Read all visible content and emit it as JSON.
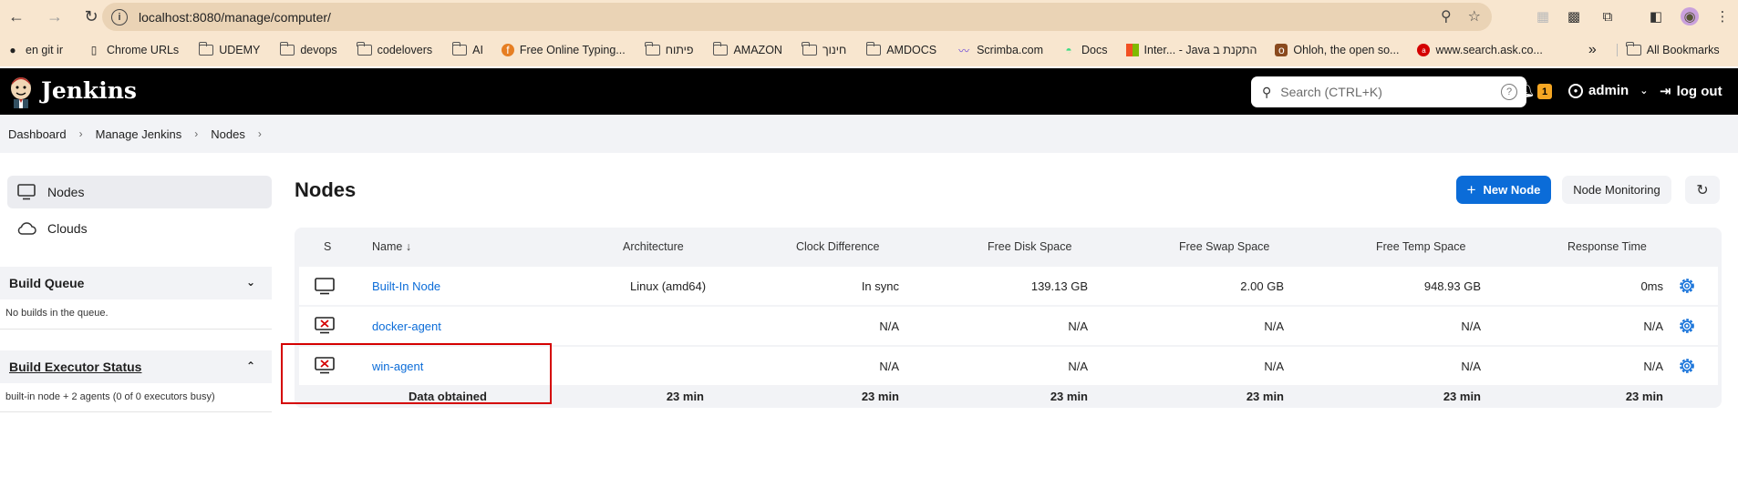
{
  "browser": {
    "url": "localhost:8080/manage/computer/",
    "bookmarks": [
      "en git ir",
      "Chrome URLs",
      "UDEMY",
      "devops",
      "codelovers",
      "AI",
      "Free Online Typing...",
      "פיתוח",
      "AMAZON",
      "חינוך",
      "AMDOCS",
      "Scrimba.com",
      "Docs",
      "Inter... - Java התקנת ב",
      "Ohloh, the open so...",
      "www.search.ask.co..."
    ],
    "all_bookmarks": "All Bookmarks"
  },
  "header": {
    "brand": "Jenkins",
    "search_placeholder": "Search (CTRL+K)",
    "notification_count": "1",
    "user": "admin",
    "logout": "log out"
  },
  "breadcrumb": [
    "Dashboard",
    "Manage Jenkins",
    "Nodes"
  ],
  "sidebar": {
    "items": [
      {
        "label": "Nodes",
        "icon": "computer-icon"
      },
      {
        "label": "Clouds",
        "icon": "cloud-icon"
      }
    ],
    "build_queue": {
      "title": "Build Queue",
      "body": "No builds in the queue."
    },
    "executor_status": {
      "title": "Build Executor Status",
      "body": "built-in node + 2 agents (0 of 0 executors busy)"
    }
  },
  "main": {
    "title": "Nodes",
    "new_node": "New Node",
    "node_monitoring": "Node Monitoring",
    "columns": [
      "S",
      "Name ↓",
      "Architecture",
      "Clock Difference",
      "Free Disk Space",
      "Free Swap Space",
      "Free Temp Space",
      "Response Time"
    ],
    "rows": [
      {
        "status": "online",
        "name": "Built-In Node",
        "arch": "Linux (amd64)",
        "clock": "In sync",
        "disk": "139.13 GB",
        "swap": "2.00 GB",
        "temp": "948.93 GB",
        "response": "0ms"
      },
      {
        "status": "offline",
        "name": "docker-agent",
        "arch": "",
        "clock": "N/A",
        "disk": "N/A",
        "swap": "N/A",
        "temp": "N/A",
        "response": "N/A"
      },
      {
        "status": "offline",
        "name": "win-agent",
        "arch": "",
        "clock": "N/A",
        "disk": "N/A",
        "swap": "N/A",
        "temp": "N/A",
        "response": "N/A"
      }
    ],
    "footer": {
      "label": "Data obtained",
      "arch": "23 min",
      "clock": "23 min",
      "disk": "23 min",
      "swap": "23 min",
      "temp": "23 min",
      "response": "23 min"
    }
  }
}
